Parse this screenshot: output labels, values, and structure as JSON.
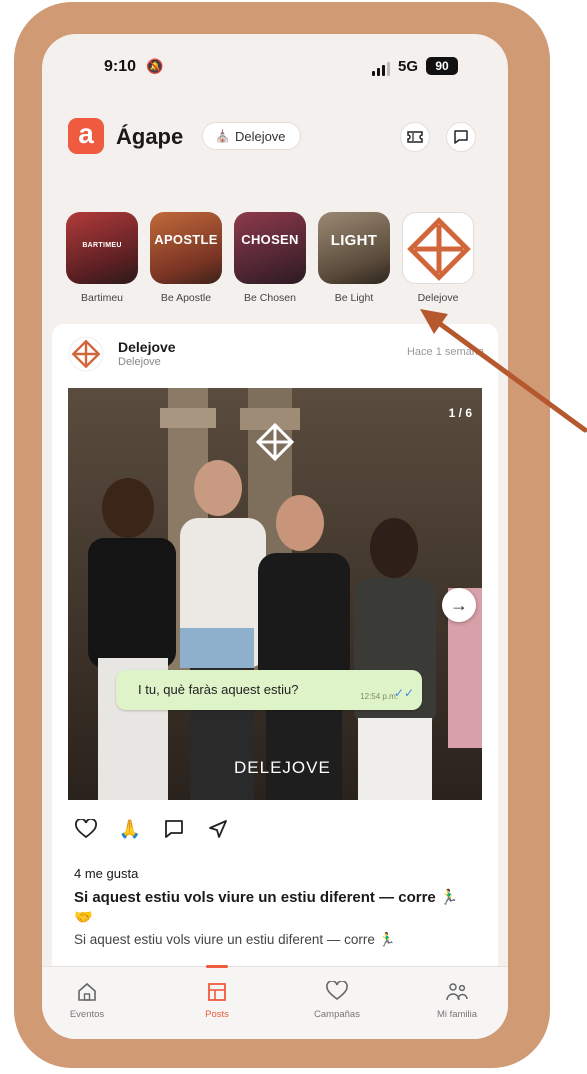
{
  "status": {
    "time": "9:10",
    "network": "5G",
    "battery": "90"
  },
  "header": {
    "app_title": "Ágape",
    "org_chip_label": "Delejove"
  },
  "stories": [
    {
      "label": "Bartimeu",
      "overlay": "BARTIMEU",
      "color": "#8c2a2a"
    },
    {
      "label": "Be Apostle",
      "overlay": "APOSTLE",
      "color": "#9a4b2c"
    },
    {
      "label": "Be Chosen",
      "overlay": "CHOSEN",
      "color": "#6b2b3a"
    },
    {
      "label": "Be Light",
      "overlay": "LIGHT",
      "color": "#6e5d4a"
    },
    {
      "label": "Delejove",
      "overlay": "",
      "color": "#ffffff"
    }
  ],
  "post": {
    "author_name": "Delejove",
    "author_sub": "Delejove",
    "time": "Hace 1 semana",
    "counter": "1 / 6",
    "bubble_text": "I tu, què faràs aquest estiu?",
    "bubble_time": "12:54 p.m.",
    "brand_mark": "DELEJOVE",
    "likes": "4 me gusta",
    "caption_title": "Si aquest estiu vols viure un estiu diferent — corre 🏃‍♂️ 🤝",
    "caption_preview": "Si aquest estiu vols viure un estiu diferent — corre 🏃‍♂️"
  },
  "nav": [
    {
      "label": "Eventos",
      "icon": "home-icon",
      "active": false
    },
    {
      "label": "Posts",
      "icon": "posts-icon",
      "active": true
    },
    {
      "label": "Campañas",
      "icon": "heart-icon",
      "active": false
    },
    {
      "label": "Mi familia",
      "icon": "family-icon",
      "active": false
    }
  ],
  "colors": {
    "accent": "#ef5b3f",
    "frame": "#d09a74",
    "arrow": "#b5582e"
  }
}
